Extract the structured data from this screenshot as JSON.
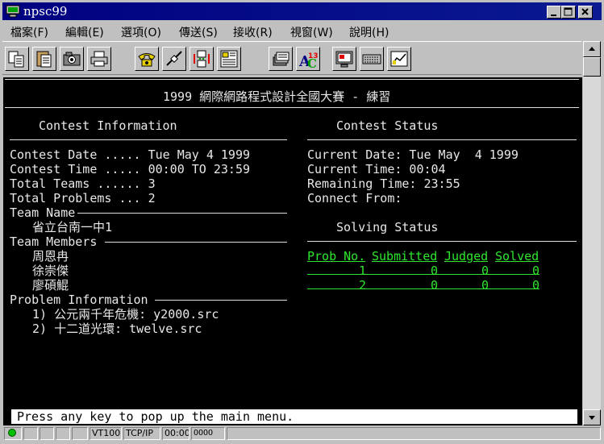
{
  "window": {
    "title": "npsc99"
  },
  "menu": [
    "檔案(F)",
    "編輯(E)",
    "選項(O)",
    "傳送(S)",
    "接收(R)",
    "視窗(W)",
    "說明(H)"
  ],
  "toolbar": [
    "copy-icon",
    "paste-icon",
    "camera-icon",
    "printer-icon",
    "phone-icon",
    "disconnect-icon",
    "transfer-icon",
    "layout-icon",
    "stack-icon",
    "spellcheck-icon",
    "monitor-icon",
    "keyboard-icon",
    "chart-icon"
  ],
  "terminal": {
    "banner": "1999 網際網路程式設計全國大賽 - 練習",
    "left": {
      "heading": "Contest Information",
      "date": "Contest Date ..... Tue May 4 1999",
      "time": "Contest Time ..... 00:00 TO 23:59",
      "teams": "Total Teams ...... 3",
      "problems": "Total Problems ... 2",
      "team_name_label": "Team Name",
      "team_name": "省立台南一中1",
      "members_label": "Team Members",
      "members": [
        "周恩冉",
        "徐崇傑",
        "廖碩鯤"
      ],
      "problem_info_label": "Problem Information",
      "problem_list": [
        "1) 公元兩千年危機: y2000.src",
        "2) 十二道光環: twelve.src"
      ]
    },
    "right": {
      "heading": "Contest Status",
      "current_date": "Current Date: Tue May  4 1999",
      "current_time": "Current Time: 00:04",
      "remaining": "Remaining Time: 23:55",
      "connect": "Connect From:",
      "solving_heading": "Solving Status",
      "table_headers": [
        "Prob No.",
        "Submitted",
        "Judged",
        "Solved"
      ],
      "rows": [
        [
          "1",
          "0",
          "0",
          "0"
        ],
        [
          "2",
          "0",
          "0",
          "0"
        ]
      ]
    },
    "prompt": "Press any key to pop up the main menu."
  },
  "status": {
    "emulation": "VT100",
    "protocol": "TCP/IP",
    "clock": "00:00",
    "indicators": "OOOO"
  },
  "colors": {
    "title_bar": "#000080",
    "terminal_bg": "#000000",
    "highlight": "#2ee62e"
  }
}
